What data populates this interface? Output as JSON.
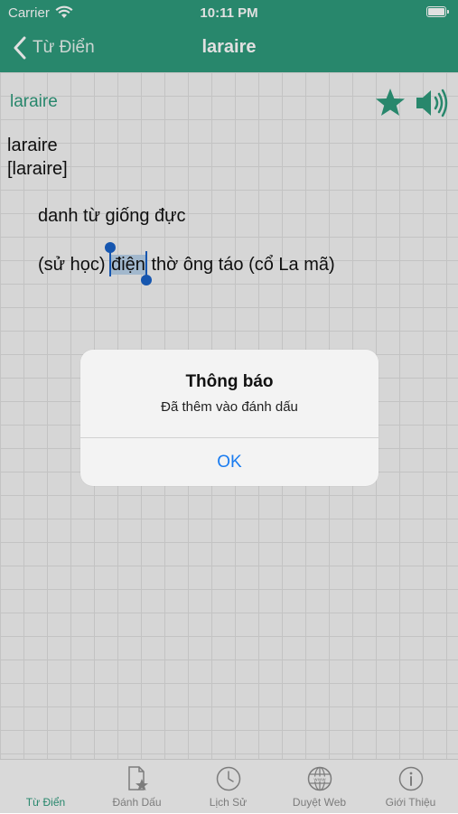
{
  "status_bar": {
    "carrier": "Carrier",
    "time": "10:11 PM"
  },
  "nav": {
    "back_label": "Từ Điển",
    "title": "laraire"
  },
  "entry": {
    "headword": "laraire",
    "word": "laraire",
    "phonetic": "[laraire]",
    "part_of_speech": "danh từ giống đực",
    "definition_before": "(sử học) ",
    "definition_selected": "điện",
    "definition_after": " thờ ông táo (cổ La mã)"
  },
  "icons": {
    "favorite": "star-icon",
    "speak": "speaker-icon"
  },
  "alert": {
    "title": "Thông báo",
    "message": "Đã thêm vào đánh dấu",
    "ok_label": "OK"
  },
  "tabs": [
    {
      "label": "Từ Điển",
      "active": true
    },
    {
      "label": "Đánh Dấu",
      "active": false
    },
    {
      "label": "Lịch Sử",
      "active": false
    },
    {
      "label": "Duyệt Web",
      "active": false
    },
    {
      "label": "Giới Thiệu",
      "active": false
    }
  ],
  "colors": {
    "brand": "#2e9a7c",
    "alert_button": "#1a7cf0",
    "tab_inactive": "#8e8e8e"
  }
}
